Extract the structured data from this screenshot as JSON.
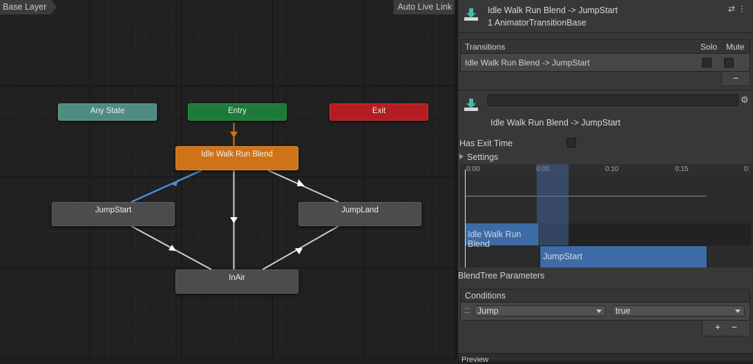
{
  "graph": {
    "breadcrumb": "Base Layer",
    "auto_live_link": "Auto Live Link",
    "nodes": {
      "any_state": "Any State",
      "entry": "Entry",
      "exit": "Exit",
      "idle": "Idle Walk Run Blend",
      "jump_start": "JumpStart",
      "jump_land": "JumpLand",
      "in_air": "InAir"
    },
    "colors": {
      "any_state": "#4e8c82",
      "entry": "#1d7a3a",
      "exit": "#b31d21",
      "default_state": "#cf7318",
      "state": "#4c4c4f",
      "selected_transition": "#4a8fd8"
    }
  },
  "inspector": {
    "title": "Idle Walk Run Blend -> JumpStart",
    "subtitle": "1 AnimatorTransitionBase",
    "transitions": {
      "header": "Transitions",
      "solo": "Solo",
      "mute": "Mute",
      "rows": [
        {
          "label": "Idle Walk Run Blend -> JumpStart",
          "solo": false,
          "mute": false
        }
      ],
      "remove": "−"
    },
    "transition_name_value": "",
    "transition_title": "Idle Walk Run Blend -> JumpStart",
    "has_exit_time": {
      "label": "Has Exit Time",
      "checked": false
    },
    "settings": {
      "label": "Settings",
      "expanded": false
    },
    "timeline": {
      "ticks": [
        "0:00",
        "0:05",
        "0:10",
        "0:15",
        "0:"
      ],
      "source_clip": "Idle Walk Run Blend",
      "target_clip": "JumpStart"
    },
    "blendtree_parameters": "BlendTree Parameters",
    "conditions": {
      "header": "Conditions",
      "rows": [
        {
          "parameter": "Jump",
          "value": "true"
        }
      ],
      "add": "+",
      "remove": "−"
    },
    "preview_label": "Preview"
  }
}
